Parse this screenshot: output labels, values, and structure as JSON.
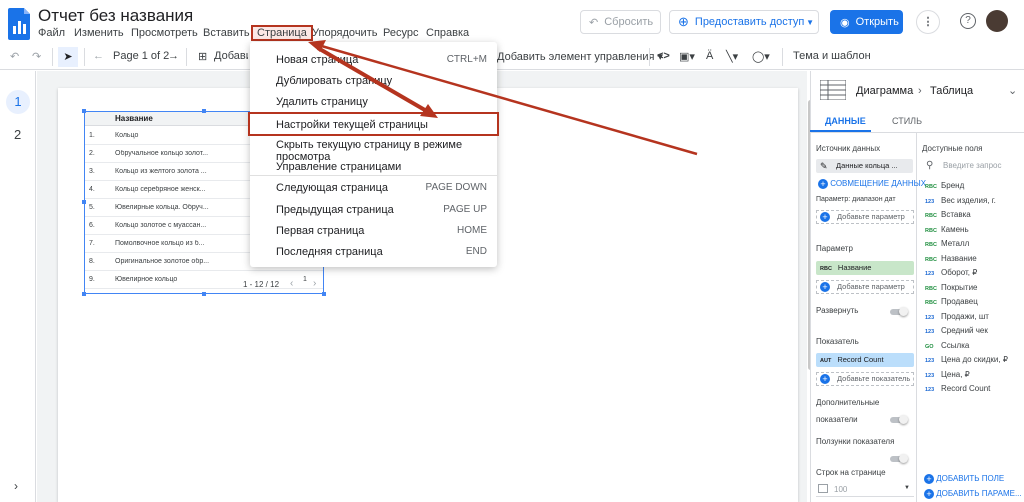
{
  "header": {
    "doc_title": "Отчет без названия",
    "menus": [
      "Файл",
      "Изменить",
      "Просмотреть",
      "Вставить",
      "Страница",
      "Упорядочить",
      "Ресурс",
      "Справка"
    ],
    "reset_label": "Сбросить",
    "share_label": "Предоставить доступ",
    "open_label": "Открыть"
  },
  "toolbar": {
    "page_label": "Page 1 of 2",
    "add_page_label": "Добавит",
    "add_control_label": "Добавить элемент управления",
    "theme_label": "Тема и шаблон"
  },
  "left_rail": {
    "pages": [
      "1",
      "2"
    ]
  },
  "dropdown": {
    "items": [
      {
        "label": "Новая страница",
        "shortcut": "CTRL+M"
      },
      {
        "label": "Дублировать страницу",
        "shortcut": ""
      },
      {
        "label": "Удалить страницу",
        "shortcut": ""
      },
      {
        "label": "Настройки текущей страницы",
        "shortcut": ""
      },
      {
        "label": "Скрыть текущую страницу в режиме просмотра",
        "shortcut": ""
      },
      {
        "label": "Управление страницами",
        "shortcut": ""
      },
      {
        "label": "Следующая страница",
        "shortcut": "PAGE DOWN"
      },
      {
        "label": "Предыдущая страница",
        "shortcut": "PAGE UP"
      },
      {
        "label": "Первая страница",
        "shortcut": "HOME"
      },
      {
        "label": "Последняя страница",
        "shortcut": "END"
      }
    ]
  },
  "table": {
    "header": "Название",
    "rows": [
      {
        "n": "1.",
        "name": "Кольцо",
        "v": ""
      },
      {
        "n": "2.",
        "name": "Обручальное кольцо золот...",
        "v": ""
      },
      {
        "n": "3.",
        "name": "Кольцо из желтого золота ...",
        "v": ""
      },
      {
        "n": "4.",
        "name": "Кольцо серебряное женск...",
        "v": ""
      },
      {
        "n": "5.",
        "name": "Ювелирные кольца. Обруч...",
        "v": ""
      },
      {
        "n": "6.",
        "name": "Кольцо золотое с муассан...",
        "v": ""
      },
      {
        "n": "7.",
        "name": "Помолвочное кольцо из б...",
        "v": ""
      },
      {
        "n": "8.",
        "name": "Оригинальное золотое обр...",
        "v": ""
      },
      {
        "n": "9.",
        "name": "Ювелирное кольцо",
        "v": "1"
      }
    ],
    "pagination": "1 - 12 / 12"
  },
  "panel": {
    "breadcrumb_a": "Диаграмма",
    "breadcrumb_b": "Таблица",
    "tab_data": "ДАННЫЕ",
    "tab_style": "СТИЛЬ",
    "source_title": "Источник данных",
    "source_value": "Данные кольца ...",
    "blend_label": "СОВМЕЩЕНИЕ ДАННЫХ",
    "date_param_label": "Параметр: диапазон дат",
    "add_param": "Добавьте параметр",
    "dimension_title": "Параметр",
    "dimension_chip": "Название",
    "dimension_type": "RBC",
    "expand_label": "Развернуть",
    "metric_title": "Показатель",
    "metric_chip": "Record Count",
    "metric_type": "AUT",
    "add_metric": "Добавьте показатель",
    "extra_metrics_1": "Дополнительные",
    "extra_metrics_2": "показатели",
    "metric_sliders": "Ползунки показателя",
    "rows_per_page": "Строк на странице",
    "rows_value": "100",
    "fields_title": "Доступные поля",
    "search_placeholder": "Введите запрос",
    "fields": [
      {
        "type": "RBC",
        "name": "Бренд"
      },
      {
        "type": "123",
        "name": "Вес изделия, г."
      },
      {
        "type": "RBC",
        "name": "Вставка"
      },
      {
        "type": "RBC",
        "name": "Камень"
      },
      {
        "type": "RBC",
        "name": "Металл"
      },
      {
        "type": "RBC",
        "name": "Название"
      },
      {
        "type": "123",
        "name": "Оборот, ₽"
      },
      {
        "type": "RBC",
        "name": "Покрытие"
      },
      {
        "type": "RBC",
        "name": "Продавец"
      },
      {
        "type": "123",
        "name": "Продажи, шт"
      },
      {
        "type": "123",
        "name": "Средний чек"
      },
      {
        "type": "GO",
        "name": "Ссылка"
      },
      {
        "type": "123",
        "name": "Цена до скидки, ₽"
      },
      {
        "type": "123",
        "name": "Цена, ₽"
      },
      {
        "type": "123",
        "name": "Record Count"
      }
    ],
    "add_field": "ДОБАВИТЬ ПОЛЕ",
    "add_param_btn": "ДОБАВИТЬ ПАРАМЕ..."
  },
  "colors": {
    "accent": "#1a73e8",
    "annotation": "#b5341f",
    "dimension_chip": "#c8e6c9",
    "metric_chip": "#bbdefb"
  }
}
